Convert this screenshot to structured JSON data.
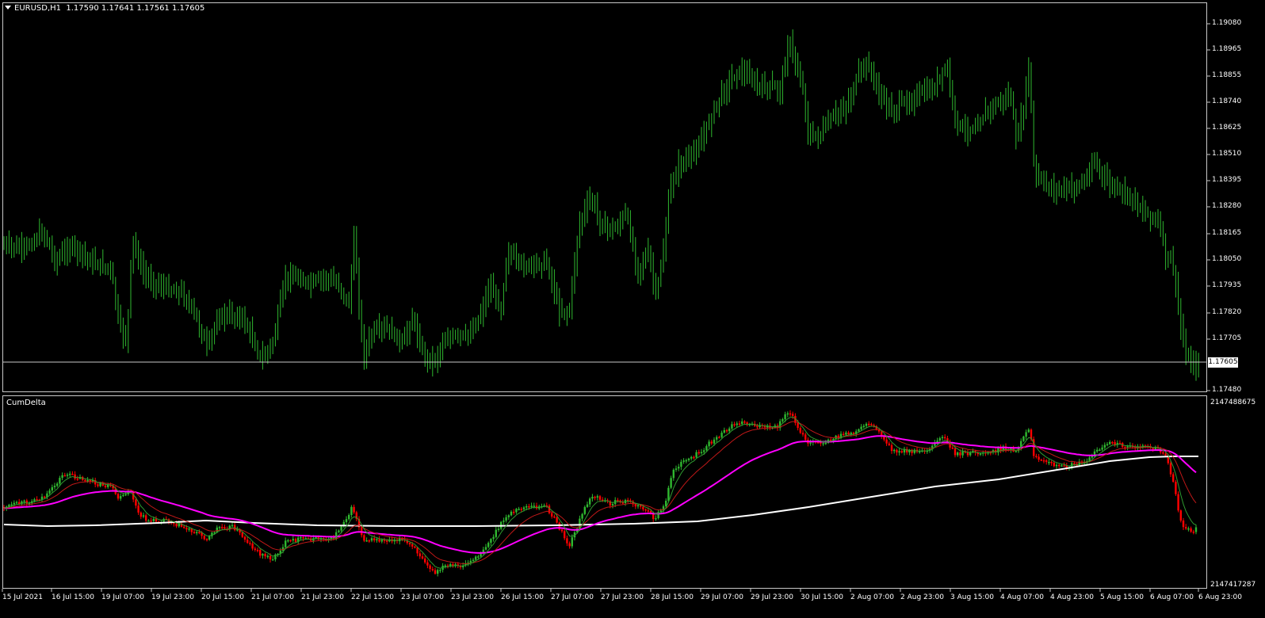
{
  "header": {
    "symbol": "EURUSD,H1",
    "ohlc": "1.17590 1.17641 1.17561 1.17605"
  },
  "indicator": {
    "name": "CumDelta",
    "scale_top": "2147488675",
    "scale_bottom": "2147417287"
  },
  "price_axis": {
    "labels": [
      "1.19080",
      "1.18965",
      "1.18855",
      "1.18740",
      "1.18625",
      "1.18510",
      "1.18395",
      "1.18280",
      "1.18165",
      "1.18050",
      "1.17935",
      "1.17820",
      "1.17705",
      "1.17480"
    ],
    "current_price": "1.17605"
  },
  "time_axis": {
    "labels": [
      "15 Jul 2021",
      "16 Jul 15:00",
      "19 Jul 07:00",
      "19 Jul 23:00",
      "20 Jul 15:00",
      "21 Jul 07:00",
      "21 Jul 23:00",
      "22 Jul 15:00",
      "23 Jul 07:00",
      "23 Jul 23:00",
      "26 Jul 15:00",
      "27 Jul 07:00",
      "27 Jul 23:00",
      "28 Jul 15:00",
      "29 Jul 07:00",
      "29 Jul 23:00",
      "30 Jul 15:00",
      "2 Aug 07:00",
      "2 Aug 23:00",
      "3 Aug 15:00",
      "4 Aug 07:00",
      "4 Aug 23:00",
      "5 Aug 15:00",
      "6 Aug 07:00",
      "6 Aug 23:00"
    ]
  },
  "colors": {
    "bars": "#2fb82f",
    "bull_candle": "#2fb82f",
    "bear_candle": "#ff0000",
    "ma_fast": "#2f9a2f",
    "ma_mid": "#c01818",
    "ma_slow": "#ff00ff",
    "ma_long": "#ffffff",
    "grid_line": "#c8c8c8"
  },
  "chart_data": {
    "type": "line",
    "title": "EURUSD,H1",
    "series": [
      {
        "name": "EURUSD,H1",
        "x": [
          "15 Jul 2021",
          "16 Jul 15:00",
          "19 Jul 07:00",
          "19 Jul 23:00",
          "20 Jul 15:00",
          "21 Jul 07:00",
          "21 Jul 23:00",
          "22 Jul 15:00",
          "23 Jul 07:00",
          "23 Jul 23:00",
          "26 Jul 15:00",
          "27 Jul 07:00",
          "27 Jul 23:00",
          "28 Jul 15:00",
          "29 Jul 07:00",
          "29 Jul 23:00",
          "30 Jul 15:00",
          "2 Aug 07:00",
          "2 Aug 23:00",
          "3 Aug 15:00",
          "4 Aug 07:00",
          "4 Aug 23:00",
          "5 Aug 15:00",
          "6 Aug 07:00",
          "6 Aug 23:00"
        ],
        "values": [
          1.181,
          1.1808,
          1.179,
          1.1792,
          1.1778,
          1.177,
          1.1795,
          1.1775,
          1.1768,
          1.1775,
          1.1808,
          1.179,
          1.1815,
          1.1835,
          1.188,
          1.1892,
          1.1868,
          1.1885,
          1.1875,
          1.1868,
          1.1878,
          1.1835,
          1.184,
          1.182,
          1.176
        ]
      },
      {
        "name": "CumDelta",
        "x": [
          "15 Jul 2021",
          "16 Jul 15:00",
          "19 Jul 07:00",
          "19 Jul 23:00",
          "20 Jul 15:00",
          "21 Jul 07:00",
          "21 Jul 23:00",
          "22 Jul 15:00",
          "23 Jul 07:00",
          "23 Jul 23:00",
          "26 Jul 15:00",
          "27 Jul 07:00",
          "27 Jul 23:00",
          "28 Jul 15:00",
          "29 Jul 07:00",
          "29 Jul 23:00",
          "30 Jul 15:00",
          "2 Aug 07:00",
          "2 Aug 23:00",
          "3 Aug 15:00",
          "4 Aug 07:00",
          "4 Aug 23:00",
          "5 Aug 15:00",
          "6 Aug 07:00",
          "6 Aug 23:00"
        ],
        "values": [
          2147448000,
          2147460000,
          2147450000,
          2147440000,
          2147434000,
          2147425000,
          2147430000,
          2147428000,
          2147420000,
          2147426000,
          2147446000,
          2147438000,
          2147448000,
          2147448000,
          2147480000,
          2147484000,
          2147472000,
          2147476000,
          2147468000,
          2147472000,
          2147470000,
          2147463000,
          2147468000,
          2147463000,
          2147440000
        ]
      }
    ],
    "ylim": [
      1.1748,
      1.1915
    ],
    "grid": false,
    "legend": "none"
  }
}
